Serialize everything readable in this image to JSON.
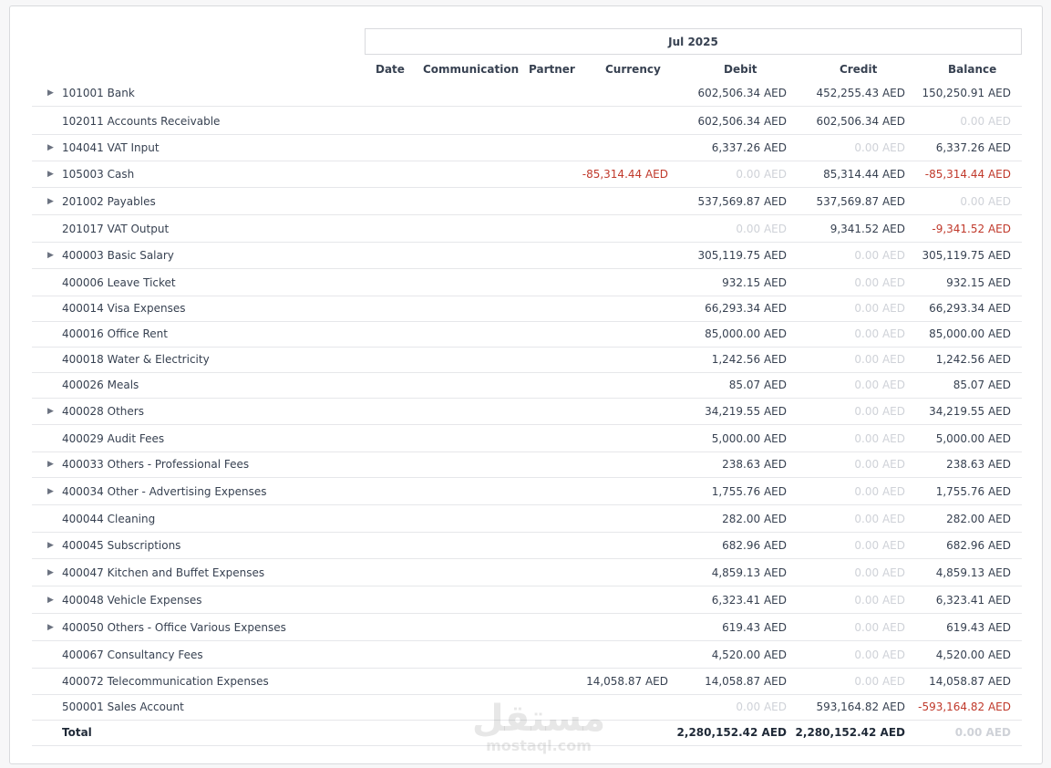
{
  "period": "Jul 2025",
  "columns": {
    "date": "Date",
    "communication": "Communication",
    "partner": "Partner",
    "currency": "Currency",
    "debit": "Debit",
    "credit": "Credit",
    "balance": "Balance"
  },
  "rows": [
    {
      "account": "101001 Bank",
      "expandable": true,
      "currency": "",
      "debit": "602,506.34 AED",
      "credit": "452,255.43 AED",
      "balance": "150,250.91 AED"
    },
    {
      "account": "102011 Accounts Receivable",
      "expandable": false,
      "currency": "",
      "debit": "602,506.34 AED",
      "credit": "602,506.34 AED",
      "balance": "0.00 AED"
    },
    {
      "account": "104041 VAT Input",
      "expandable": true,
      "currency": "",
      "debit": "6,337.26 AED",
      "credit": "0.00 AED",
      "balance": "6,337.26 AED"
    },
    {
      "account": "105003 Cash",
      "expandable": true,
      "currency": "-85,314.44 AED",
      "debit": "0.00 AED",
      "credit": "85,314.44 AED",
      "balance": "-85,314.44 AED"
    },
    {
      "account": "201002 Payables",
      "expandable": true,
      "currency": "",
      "debit": "537,569.87 AED",
      "credit": "537,569.87 AED",
      "balance": "0.00 AED"
    },
    {
      "account": "201017 VAT Output",
      "expandable": false,
      "currency": "",
      "debit": "0.00 AED",
      "credit": "9,341.52 AED",
      "balance": "-9,341.52 AED"
    },
    {
      "account": "400003 Basic Salary",
      "expandable": true,
      "currency": "",
      "debit": "305,119.75 AED",
      "credit": "0.00 AED",
      "balance": "305,119.75 AED"
    },
    {
      "account": "400006 Leave Ticket",
      "expandable": false,
      "currency": "",
      "debit": "932.15 AED",
      "credit": "0.00 AED",
      "balance": "932.15 AED"
    },
    {
      "account": "400014 Visa Expenses",
      "expandable": false,
      "currency": "",
      "debit": "66,293.34 AED",
      "credit": "0.00 AED",
      "balance": "66,293.34 AED"
    },
    {
      "account": "400016 Office Rent",
      "expandable": false,
      "currency": "",
      "debit": "85,000.00 AED",
      "credit": "0.00 AED",
      "balance": "85,000.00 AED"
    },
    {
      "account": "400018 Water & Electricity",
      "expandable": false,
      "currency": "",
      "debit": "1,242.56 AED",
      "credit": "0.00 AED",
      "balance": "1,242.56 AED"
    },
    {
      "account": "400026 Meals",
      "expandable": false,
      "currency": "",
      "debit": "85.07 AED",
      "credit": "0.00 AED",
      "balance": "85.07 AED"
    },
    {
      "account": "400028 Others",
      "expandable": true,
      "currency": "",
      "debit": "34,219.55 AED",
      "credit": "0.00 AED",
      "balance": "34,219.55 AED"
    },
    {
      "account": "400029 Audit Fees",
      "expandable": false,
      "currency": "",
      "debit": "5,000.00 AED",
      "credit": "0.00 AED",
      "balance": "5,000.00 AED"
    },
    {
      "account": "400033 Others - Professional Fees",
      "expandable": true,
      "currency": "",
      "debit": "238.63 AED",
      "credit": "0.00 AED",
      "balance": "238.63 AED"
    },
    {
      "account": "400034 Other - Advertising Expenses",
      "expandable": true,
      "currency": "",
      "debit": "1,755.76 AED",
      "credit": "0.00 AED",
      "balance": "1,755.76 AED"
    },
    {
      "account": "400044 Cleaning",
      "expandable": false,
      "currency": "",
      "debit": "282.00 AED",
      "credit": "0.00 AED",
      "balance": "282.00 AED"
    },
    {
      "account": "400045 Subscriptions",
      "expandable": true,
      "currency": "",
      "debit": "682.96 AED",
      "credit": "0.00 AED",
      "balance": "682.96 AED"
    },
    {
      "account": "400047 Kitchen and Buffet Expenses",
      "expandable": true,
      "currency": "",
      "debit": "4,859.13 AED",
      "credit": "0.00 AED",
      "balance": "4,859.13 AED"
    },
    {
      "account": "400048 Vehicle Expenses",
      "expandable": true,
      "currency": "",
      "debit": "6,323.41 AED",
      "credit": "0.00 AED",
      "balance": "6,323.41 AED"
    },
    {
      "account": "400050 Others - Office Various Expenses",
      "expandable": true,
      "currency": "",
      "debit": "619.43 AED",
      "credit": "0.00 AED",
      "balance": "619.43 AED"
    },
    {
      "account": "400067 Consultancy Fees",
      "expandable": false,
      "currency": "",
      "debit": "4,520.00 AED",
      "credit": "0.00 AED",
      "balance": "4,520.00 AED"
    },
    {
      "account": "400072 Telecommunication Expenses",
      "expandable": false,
      "currency": "14,058.87 AED",
      "debit": "14,058.87 AED",
      "credit": "0.00 AED",
      "balance": "14,058.87 AED"
    },
    {
      "account": "500001 Sales Account",
      "expandable": false,
      "currency": "",
      "debit": "0.00 AED",
      "credit": "593,164.82 AED",
      "balance": "-593,164.82 AED"
    }
  ],
  "total": {
    "label": "Total",
    "debit": "2,280,152.42 AED",
    "credit": "2,280,152.42 AED",
    "balance": "0.00 AED"
  },
  "watermark": {
    "arabic": "مستقل",
    "latin": "mostaql.com"
  },
  "icons": {
    "expand": "caret-right-icon"
  },
  "colors": {
    "negative": "#c0392b",
    "zero": "#cfd2d8",
    "border": "#e6e7ea"
  }
}
